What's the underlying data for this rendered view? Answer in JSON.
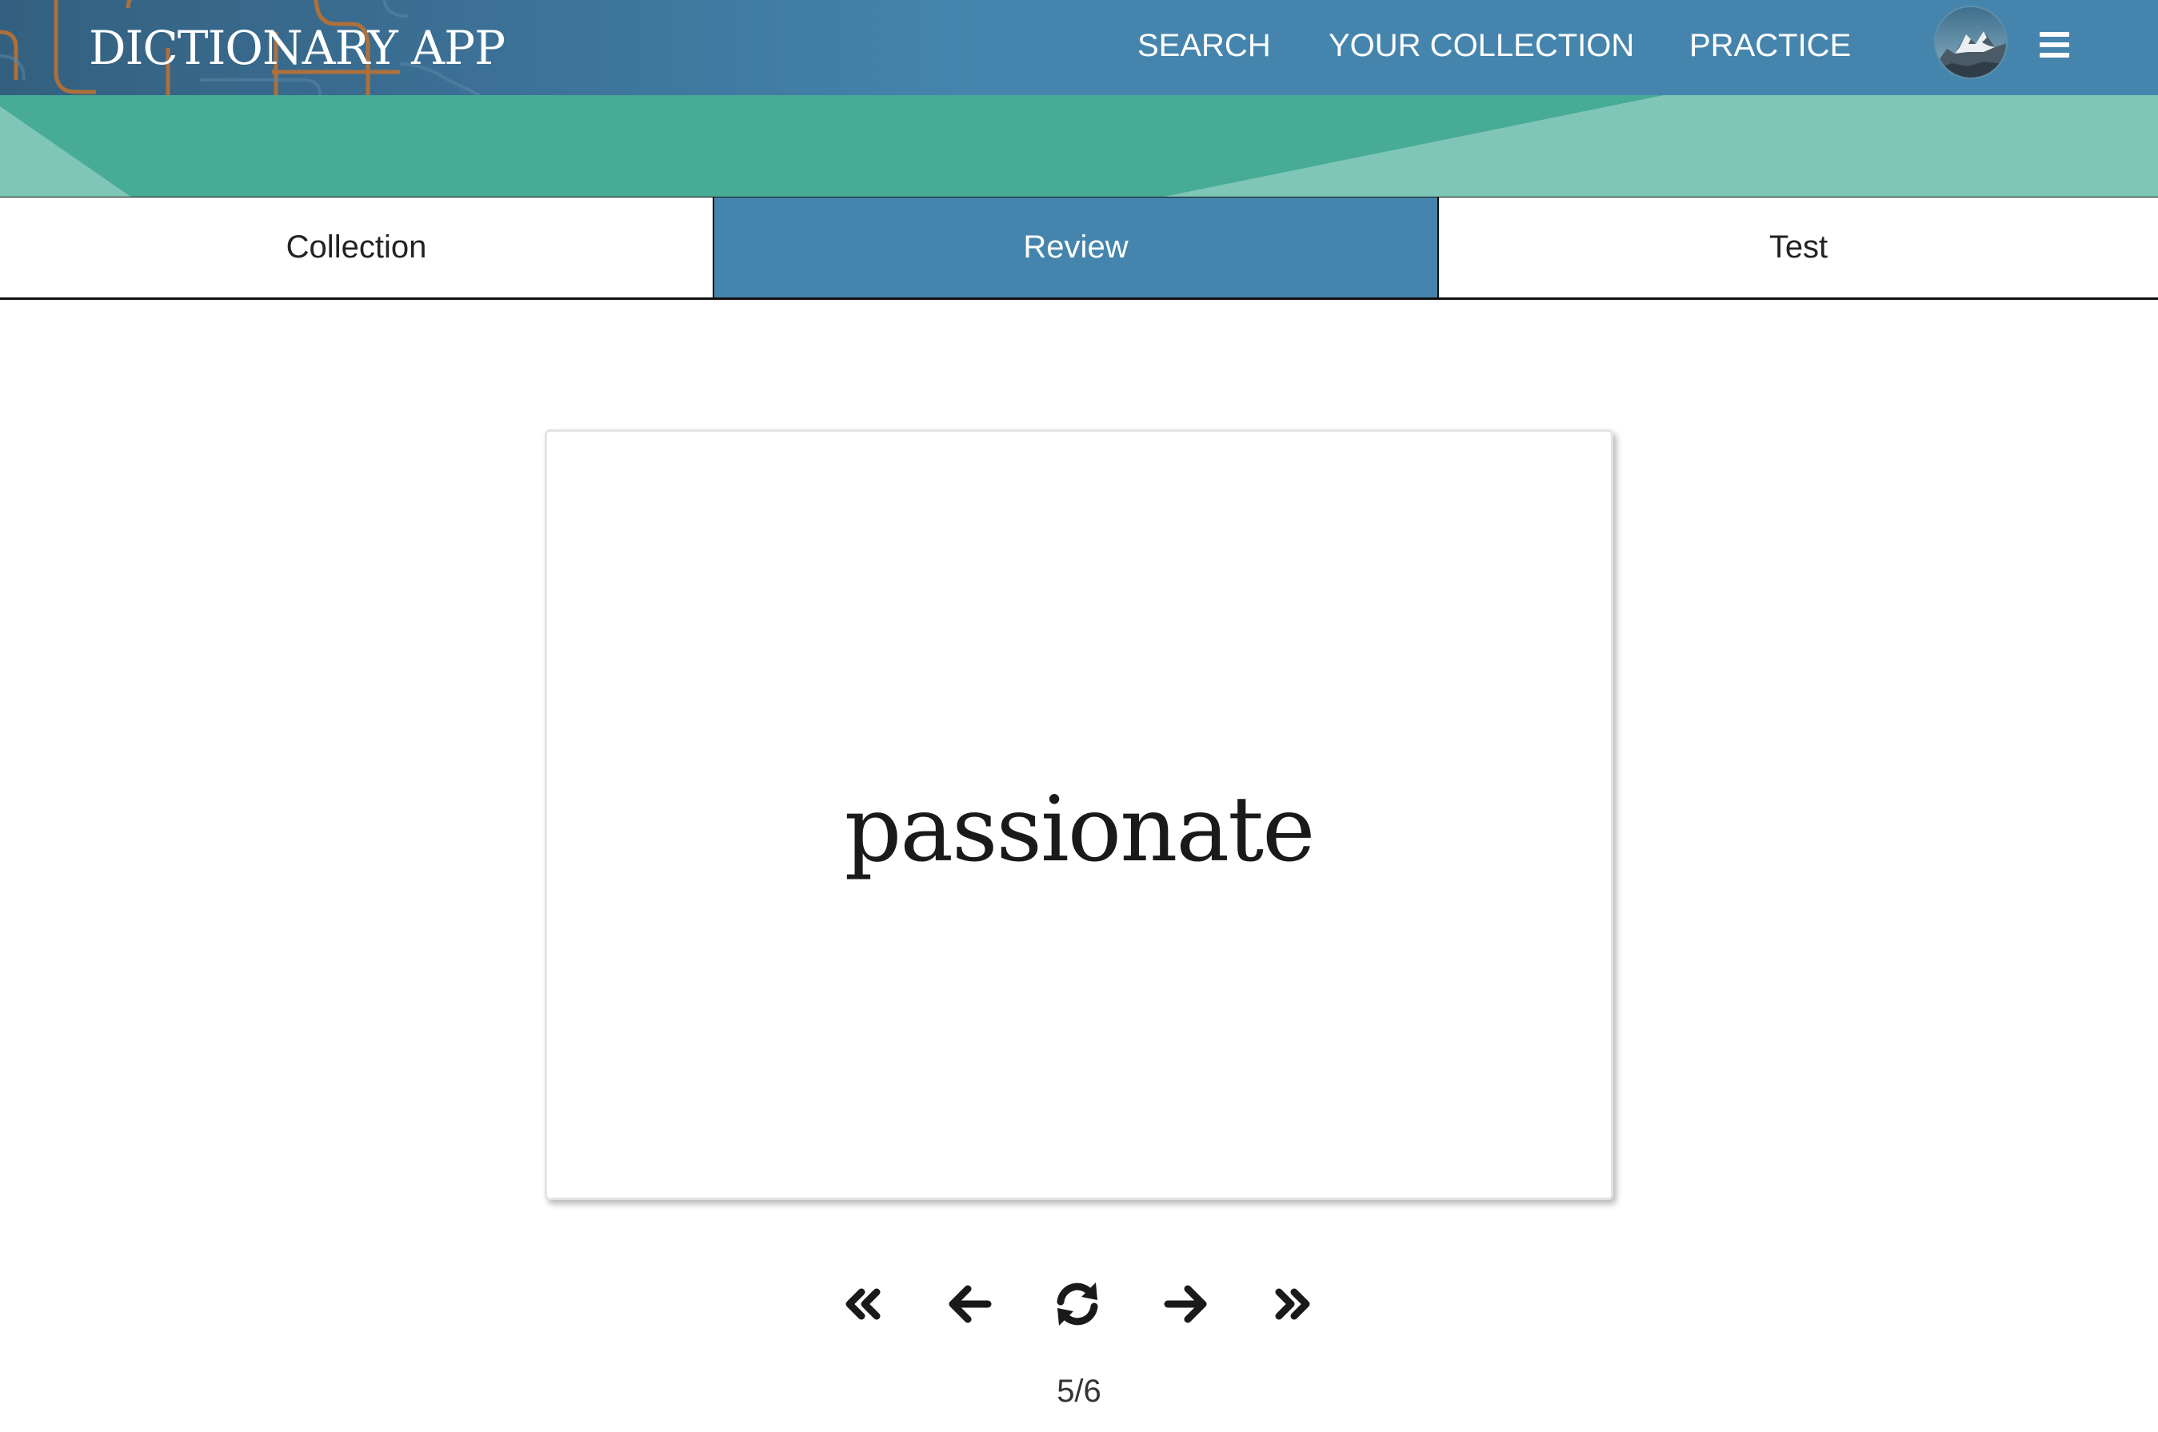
{
  "header": {
    "brand": "DICTIONARY APP",
    "nav": {
      "search": "SEARCH",
      "collection": "YOUR COLLECTION",
      "practice": "PRACTICE"
    },
    "colors": {
      "header_blue": "#4585ad",
      "band_green": "#47ab96",
      "band_light": "#7fc6b6",
      "deco_orange": "#c4722e"
    },
    "icons": {
      "avatar": "mountain-avatar",
      "menu": "hamburger-menu-icon"
    }
  },
  "tabs": {
    "collection": "Collection",
    "review": "Review",
    "test": "Test",
    "active": "Review"
  },
  "card": {
    "word": "passionate"
  },
  "controls": {
    "icons": [
      "double-chevron-left-icon",
      "arrow-left-icon",
      "refresh-icon",
      "arrow-right-icon",
      "double-chevron-right-icon"
    ],
    "counter": "5/6"
  }
}
